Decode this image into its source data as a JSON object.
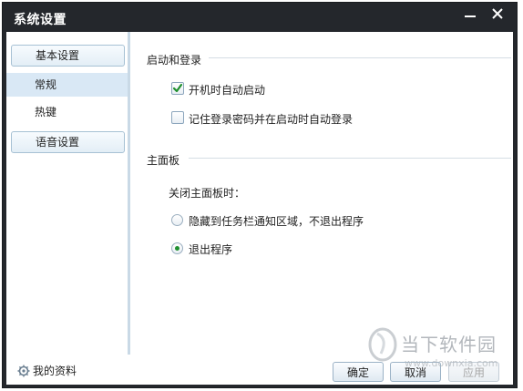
{
  "window": {
    "title": "系统设置",
    "minimize_icon": "minimize-icon",
    "close_icon": "close-icon"
  },
  "sidebar": {
    "groups": [
      {
        "label": "基本设置"
      },
      {
        "label": "语音设置"
      }
    ],
    "items": [
      {
        "label": "常规",
        "active": true
      },
      {
        "label": "热键",
        "active": false
      }
    ]
  },
  "main": {
    "startup": {
      "title": "启动和登录",
      "options": [
        {
          "label": "开机时自动启动",
          "checked": true
        },
        {
          "label": "记住登录密码并在启动时自动登录",
          "checked": false
        }
      ]
    },
    "panel": {
      "title": "主面板",
      "subtitle": "关闭主面板时：",
      "options": [
        {
          "label": "隐藏到任务栏通知区域，不退出程序",
          "selected": false
        },
        {
          "label": "退出程序",
          "selected": true
        }
      ]
    }
  },
  "footer": {
    "profile_label": "我的资料",
    "profile_icon": "gear-icon",
    "ok_label": "确定",
    "cancel_label": "取消",
    "apply_label": "应用"
  },
  "watermark": {
    "text": "当下软件园",
    "url": "www.downxia.com"
  },
  "colors": {
    "titlebar": "#24272c",
    "sidebar_active": "#d9e8f5",
    "check_green": "#1f8f2e"
  }
}
